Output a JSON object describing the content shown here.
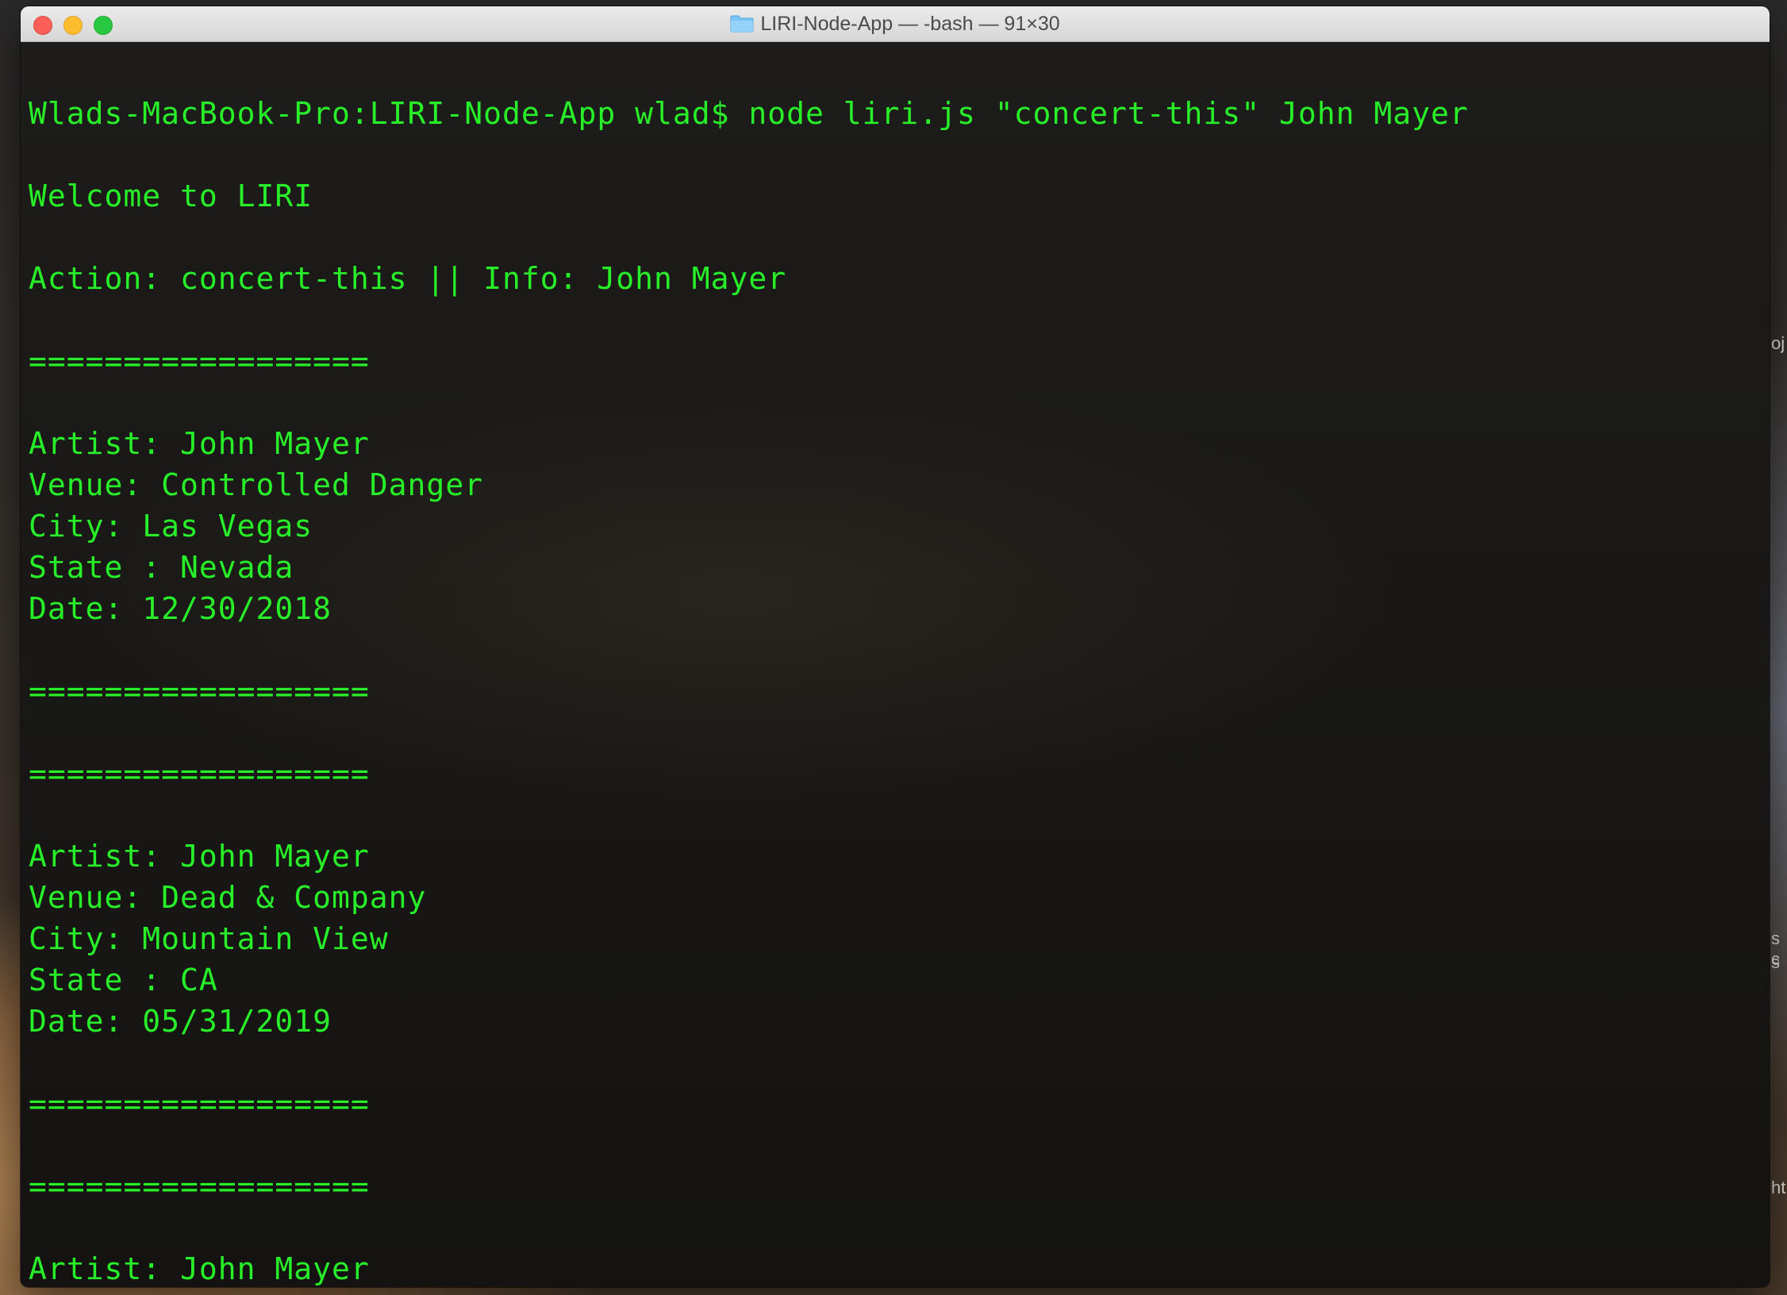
{
  "window": {
    "title": "LIRI-Node-App — -bash — 91×30",
    "text_color": "#28f028",
    "traffic_colors": {
      "close": "#fc5f57",
      "minimize": "#fdbc2e",
      "zoom": "#28c840"
    }
  },
  "desktop": {
    "peek_labels": [
      "oj",
      "s c",
      "s",
      "ht"
    ]
  },
  "terminal": {
    "lines": [
      "",
      "Wlads-MacBook-Pro:LIRI-Node-App wlad$ node liri.js \"concert-this\" John Mayer",
      "",
      "Welcome to LIRI",
      "",
      "Action: concert-this || Info: John Mayer",
      "",
      "==================",
      "",
      "Artist: John Mayer",
      "Venue: Controlled Danger",
      "City: Las Vegas",
      "State : Nevada",
      "Date: 12/30/2018",
      "",
      "==================",
      "",
      "==================",
      "",
      "Artist: John Mayer",
      "Venue: Dead & Company",
      "City: Mountain View",
      "State : CA",
      "Date: 05/31/2019",
      "",
      "==================",
      "",
      "==================",
      "",
      "Artist: John Mayer"
    ]
  }
}
